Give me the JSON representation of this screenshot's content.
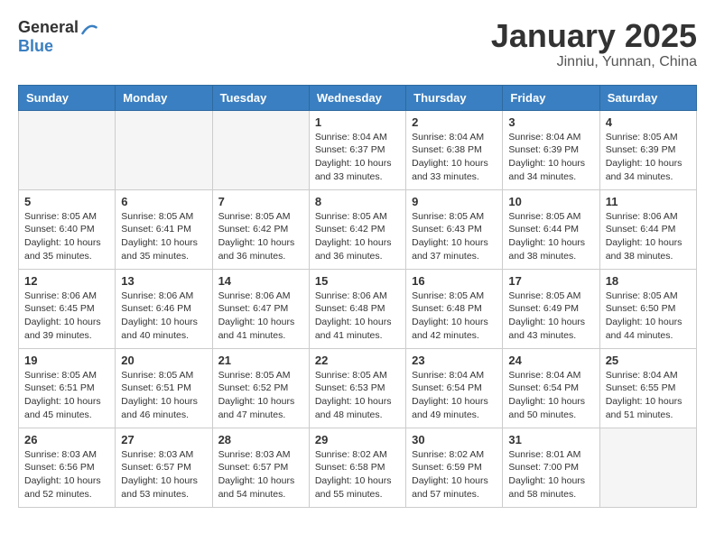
{
  "logo": {
    "general": "General",
    "blue": "Blue"
  },
  "title": "January 2025",
  "subtitle": "Jinniu, Yunnan, China",
  "weekdays": [
    "Sunday",
    "Monday",
    "Tuesday",
    "Wednesday",
    "Thursday",
    "Friday",
    "Saturday"
  ],
  "weeks": [
    [
      {
        "day": "",
        "info": ""
      },
      {
        "day": "",
        "info": ""
      },
      {
        "day": "",
        "info": ""
      },
      {
        "day": "1",
        "info": "Sunrise: 8:04 AM\nSunset: 6:37 PM\nDaylight: 10 hours\nand 33 minutes."
      },
      {
        "day": "2",
        "info": "Sunrise: 8:04 AM\nSunset: 6:38 PM\nDaylight: 10 hours\nand 33 minutes."
      },
      {
        "day": "3",
        "info": "Sunrise: 8:04 AM\nSunset: 6:39 PM\nDaylight: 10 hours\nand 34 minutes."
      },
      {
        "day": "4",
        "info": "Sunrise: 8:05 AM\nSunset: 6:39 PM\nDaylight: 10 hours\nand 34 minutes."
      }
    ],
    [
      {
        "day": "5",
        "info": "Sunrise: 8:05 AM\nSunset: 6:40 PM\nDaylight: 10 hours\nand 35 minutes."
      },
      {
        "day": "6",
        "info": "Sunrise: 8:05 AM\nSunset: 6:41 PM\nDaylight: 10 hours\nand 35 minutes."
      },
      {
        "day": "7",
        "info": "Sunrise: 8:05 AM\nSunset: 6:42 PM\nDaylight: 10 hours\nand 36 minutes."
      },
      {
        "day": "8",
        "info": "Sunrise: 8:05 AM\nSunset: 6:42 PM\nDaylight: 10 hours\nand 36 minutes."
      },
      {
        "day": "9",
        "info": "Sunrise: 8:05 AM\nSunset: 6:43 PM\nDaylight: 10 hours\nand 37 minutes."
      },
      {
        "day": "10",
        "info": "Sunrise: 8:05 AM\nSunset: 6:44 PM\nDaylight: 10 hours\nand 38 minutes."
      },
      {
        "day": "11",
        "info": "Sunrise: 8:06 AM\nSunset: 6:44 PM\nDaylight: 10 hours\nand 38 minutes."
      }
    ],
    [
      {
        "day": "12",
        "info": "Sunrise: 8:06 AM\nSunset: 6:45 PM\nDaylight: 10 hours\nand 39 minutes."
      },
      {
        "day": "13",
        "info": "Sunrise: 8:06 AM\nSunset: 6:46 PM\nDaylight: 10 hours\nand 40 minutes."
      },
      {
        "day": "14",
        "info": "Sunrise: 8:06 AM\nSunset: 6:47 PM\nDaylight: 10 hours\nand 41 minutes."
      },
      {
        "day": "15",
        "info": "Sunrise: 8:06 AM\nSunset: 6:48 PM\nDaylight: 10 hours\nand 41 minutes."
      },
      {
        "day": "16",
        "info": "Sunrise: 8:05 AM\nSunset: 6:48 PM\nDaylight: 10 hours\nand 42 minutes."
      },
      {
        "day": "17",
        "info": "Sunrise: 8:05 AM\nSunset: 6:49 PM\nDaylight: 10 hours\nand 43 minutes."
      },
      {
        "day": "18",
        "info": "Sunrise: 8:05 AM\nSunset: 6:50 PM\nDaylight: 10 hours\nand 44 minutes."
      }
    ],
    [
      {
        "day": "19",
        "info": "Sunrise: 8:05 AM\nSunset: 6:51 PM\nDaylight: 10 hours\nand 45 minutes."
      },
      {
        "day": "20",
        "info": "Sunrise: 8:05 AM\nSunset: 6:51 PM\nDaylight: 10 hours\nand 46 minutes."
      },
      {
        "day": "21",
        "info": "Sunrise: 8:05 AM\nSunset: 6:52 PM\nDaylight: 10 hours\nand 47 minutes."
      },
      {
        "day": "22",
        "info": "Sunrise: 8:05 AM\nSunset: 6:53 PM\nDaylight: 10 hours\nand 48 minutes."
      },
      {
        "day": "23",
        "info": "Sunrise: 8:04 AM\nSunset: 6:54 PM\nDaylight: 10 hours\nand 49 minutes."
      },
      {
        "day": "24",
        "info": "Sunrise: 8:04 AM\nSunset: 6:54 PM\nDaylight: 10 hours\nand 50 minutes."
      },
      {
        "day": "25",
        "info": "Sunrise: 8:04 AM\nSunset: 6:55 PM\nDaylight: 10 hours\nand 51 minutes."
      }
    ],
    [
      {
        "day": "26",
        "info": "Sunrise: 8:03 AM\nSunset: 6:56 PM\nDaylight: 10 hours\nand 52 minutes."
      },
      {
        "day": "27",
        "info": "Sunrise: 8:03 AM\nSunset: 6:57 PM\nDaylight: 10 hours\nand 53 minutes."
      },
      {
        "day": "28",
        "info": "Sunrise: 8:03 AM\nSunset: 6:57 PM\nDaylight: 10 hours\nand 54 minutes."
      },
      {
        "day": "29",
        "info": "Sunrise: 8:02 AM\nSunset: 6:58 PM\nDaylight: 10 hours\nand 55 minutes."
      },
      {
        "day": "30",
        "info": "Sunrise: 8:02 AM\nSunset: 6:59 PM\nDaylight: 10 hours\nand 57 minutes."
      },
      {
        "day": "31",
        "info": "Sunrise: 8:01 AM\nSunset: 7:00 PM\nDaylight: 10 hours\nand 58 minutes."
      },
      {
        "day": "",
        "info": ""
      }
    ]
  ]
}
